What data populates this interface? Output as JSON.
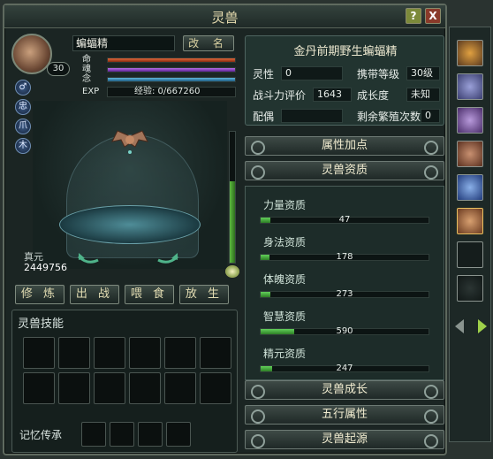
{
  "window": {
    "title": "灵兽",
    "help_label": "?",
    "close_label": "X"
  },
  "pet": {
    "name": "蝙蝠精",
    "level": "30",
    "rename_label": "改 名",
    "bars": {
      "ming": "命",
      "hun": "魂",
      "nian": "念",
      "exp": "EXP"
    },
    "exp_text": "经验: 0/667260",
    "side_icons": [
      "♂",
      "忠",
      "爪",
      "木"
    ],
    "zhenyuan_label": "真元",
    "zhenyuan_value": "2449756"
  },
  "actions": [
    "修 炼",
    "出 战",
    "喂 食",
    "放 生"
  ],
  "skills": {
    "title": "灵兽技能",
    "memory_label": "记忆传承"
  },
  "info": {
    "title": "金丹前期野生蝙蝠精",
    "lingxing_label": "灵性",
    "lingxing_value": "0",
    "carry_label": "携带等级",
    "carry_value": "30级",
    "power_label": "战斗力评价",
    "power_value": "1643",
    "growth_label": "成长度",
    "growth_value": "未知",
    "mate_label": "配偶",
    "mate_value": "",
    "breed_label": "剩余繁殖次数",
    "breed_value": "0"
  },
  "sections": {
    "attr": "属性加点",
    "aptitude": "灵兽资质",
    "growth": "灵兽成长",
    "wuxing": "五行属性",
    "origin": "灵兽起源"
  },
  "aptitudes": [
    {
      "label": "力量资质",
      "value": "47",
      "fill": 0.06
    },
    {
      "label": "身法资质",
      "value": "178",
      "fill": 0.05
    },
    {
      "label": "体魄资质",
      "value": "273",
      "fill": 0.06
    },
    {
      "label": "智慧资质",
      "value": "590",
      "fill": 0.2
    },
    {
      "label": "精元资质",
      "value": "247",
      "fill": 0.07
    }
  ],
  "vertical_gauge_fill": 0.62
}
